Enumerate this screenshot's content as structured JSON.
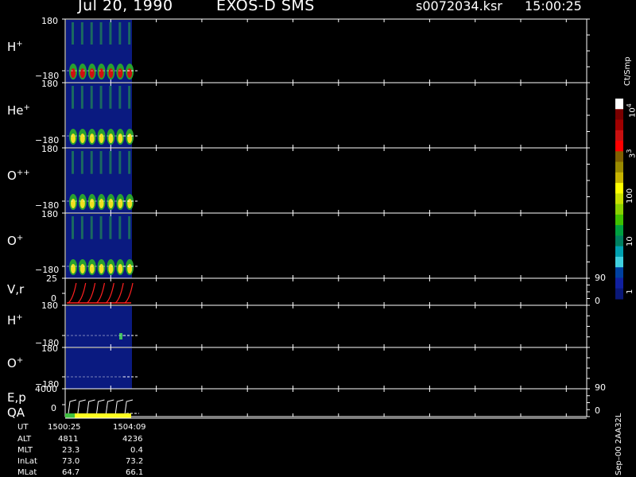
{
  "header": {
    "date": "Jul 20, 1990",
    "instrument": "EXOS-D SMS",
    "file": "s0072034.ksr",
    "time": "15:00:25"
  },
  "chart_data": {
    "type": "heatmap",
    "panels": [
      {
        "id": "h-plus",
        "species": "H",
        "charge": "+",
        "ytop": "180",
        "ybottom": "−180"
      },
      {
        "id": "he-plus",
        "species": "He",
        "charge": "+",
        "ytop": "180",
        "ybottom": "−180"
      },
      {
        "id": "o-plusplus",
        "species": "O",
        "charge": "++",
        "ytop": "180",
        "ybottom": "−180"
      },
      {
        "id": "o-plus",
        "species": "O",
        "charge": "+",
        "ytop": "180",
        "ybottom": "−180"
      },
      {
        "id": "vr",
        "species": "V,r",
        "charge": "",
        "ytop": "25",
        "ybottom": "0",
        "right_top": "90",
        "right_bottom": "0"
      },
      {
        "id": "h-plus-2",
        "species": "H",
        "charge": "+",
        "ytop": "180",
        "ybottom": "−180"
      },
      {
        "id": "o-plus-2",
        "species": "O",
        "charge": "+",
        "ytop": "180",
        "ybottom": "−180"
      },
      {
        "id": "ep",
        "species": "E,p",
        "charge": "",
        "ytop": "4000",
        "ybottom": "0",
        "right_top": "90",
        "right_bottom": "0"
      }
    ],
    "qa_label": "QA",
    "colorbar": {
      "unit": "Ct/Smp",
      "tick_labels": [
        "10",
        "3",
        "100",
        "10",
        "1"
      ],
      "tick_exponents": {
        "top": "4",
        "mid": "3"
      },
      "colors": [
        "#ffffff",
        "#7a0000",
        "#a00000",
        "#c81010",
        "#ff0000",
        "#806000",
        "#9a8a00",
        "#c8b400",
        "#ffff00",
        "#c8e000",
        "#8ad000",
        "#40c000",
        "#00a040",
        "#008060",
        "#00a0b0",
        "#40d0e0",
        "#0040a0",
        "#1020a0",
        "#0a1878"
      ]
    },
    "data_time_fraction": 0.126,
    "pulse_count": 7,
    "ephemeris": {
      "labels": [
        "UT",
        "ALT",
        "MLT",
        "InLat",
        "MLat"
      ],
      "col1": [
        "1500:25",
        "4811",
        "23.3",
        "73.0",
        "64.7"
      ],
      "col2": [
        "1504:09",
        "4236",
        "0.4",
        "73.2",
        "66.1"
      ]
    },
    "footer_vertical": "Sep–00  2AA32L"
  }
}
